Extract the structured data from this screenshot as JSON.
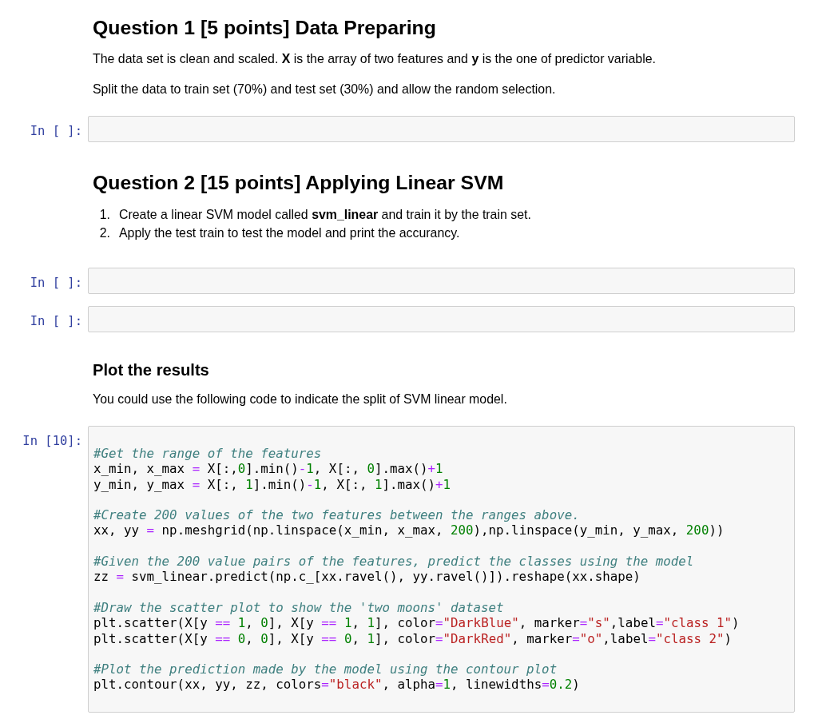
{
  "cells": [
    {
      "kind": "markdown",
      "blocks": [
        {
          "kind": "heading",
          "text": "Question 1 [5 points] Data Preparing"
        },
        {
          "kind": "paragraph",
          "text": "The data set is clean and scaled. **X** is the array of two features and **y** is the one of predictor variable."
        },
        {
          "kind": "paragraph",
          "text": "Split the data to train set (70%) and test set (30%) and allow the random selection."
        }
      ]
    },
    {
      "kind": "code",
      "prompt": "In [ ]:"
    },
    {
      "kind": "markdown",
      "blocks": [
        {
          "kind": "heading",
          "text": "Question 2 [15 points] Applying Linear SVM"
        },
        {
          "kind": "list",
          "items": [
            {
              "number": "1.",
              "text": "Create a linear SVM model called **svm_linear** and train it by the train set."
            },
            {
              "number": "2.",
              "text": "Apply the test train to test the model and print the accurancy."
            }
          ]
        }
      ]
    },
    {
      "kind": "code",
      "prompt": "In [ ]:"
    },
    {
      "kind": "code",
      "prompt": "In [ ]:"
    },
    {
      "kind": "markdown",
      "blocks": [
        {
          "kind": "subheading",
          "text": "Plot the results"
        },
        {
          "kind": "paragraph",
          "text": "You could use the following code to indicate the split of SVM linear model."
        }
      ]
    },
    {
      "kind": "code",
      "prompt": "In [10]:",
      "code": [
        [
          [
            {
              "kind": "comment",
              "text": "#Get the range of the features"
            }
          ],
          [
            {
              "kind": "plain",
              "text": "x_min, x_max "
            },
            {
              "kind": "operator",
              "text": "="
            },
            {
              "kind": "plain",
              "text": " X[:,"
            },
            {
              "kind": "number",
              "text": "0"
            },
            {
              "kind": "plain",
              "text": "].min()"
            },
            {
              "kind": "operator",
              "text": "-"
            },
            {
              "kind": "number",
              "text": "1"
            },
            {
              "kind": "plain",
              "text": ", X[:, "
            },
            {
              "kind": "number",
              "text": "0"
            },
            {
              "kind": "plain",
              "text": "].max()"
            },
            {
              "kind": "operator",
              "text": "+"
            },
            {
              "kind": "number",
              "text": "1"
            }
          ],
          [
            {
              "kind": "plain",
              "text": "y_min, y_max "
            },
            {
              "kind": "operator",
              "text": "="
            },
            {
              "kind": "plain",
              "text": " X[:, "
            },
            {
              "kind": "number",
              "text": "1"
            },
            {
              "kind": "plain",
              "text": "].min()"
            },
            {
              "kind": "operator",
              "text": "-"
            },
            {
              "kind": "number",
              "text": "1"
            },
            {
              "kind": "plain",
              "text": ", X[:, "
            },
            {
              "kind": "number",
              "text": "1"
            },
            {
              "kind": "plain",
              "text": "].max()"
            },
            {
              "kind": "operator",
              "text": "+"
            },
            {
              "kind": "number",
              "text": "1"
            }
          ]
        ],
        [
          [
            {
              "kind": "comment",
              "text": "#Create 200 values of the two features between the ranges above."
            }
          ],
          [
            {
              "kind": "plain",
              "text": "xx, yy "
            },
            {
              "kind": "operator",
              "text": "="
            },
            {
              "kind": "plain",
              "text": " np.meshgrid(np.linspace(x_min, x_max, "
            },
            {
              "kind": "number",
              "text": "200"
            },
            {
              "kind": "plain",
              "text": "),np.linspace(y_min, y_max, "
            },
            {
              "kind": "number",
              "text": "200"
            },
            {
              "kind": "plain",
              "text": "))"
            }
          ]
        ],
        [
          [
            {
              "kind": "comment",
              "text": "#Given the 200 value pairs of the features, predict the classes using the model"
            }
          ],
          [
            {
              "kind": "plain",
              "text": "zz "
            },
            {
              "kind": "operator",
              "text": "="
            },
            {
              "kind": "plain",
              "text": " svm_linear.predict(np.c_[xx.ravel(), yy.ravel()]).reshape(xx.shape)"
            }
          ]
        ],
        [
          [
            {
              "kind": "comment",
              "text": "#Draw the scatter plot to show the 'two moons' dataset"
            }
          ],
          [
            {
              "kind": "plain",
              "text": "plt.scatter(X[y "
            },
            {
              "kind": "operator",
              "text": "=="
            },
            {
              "kind": "number",
              "text": " 1"
            },
            {
              "kind": "plain",
              "text": ", "
            },
            {
              "kind": "number",
              "text": "0"
            },
            {
              "kind": "plain",
              "text": "], X[y "
            },
            {
              "kind": "operator",
              "text": "=="
            },
            {
              "kind": "number",
              "text": " 1"
            },
            {
              "kind": "plain",
              "text": ", "
            },
            {
              "kind": "number",
              "text": "1"
            },
            {
              "kind": "plain",
              "text": "], color"
            },
            {
              "kind": "operator",
              "text": "="
            },
            {
              "kind": "string",
              "text": "\"DarkBlue\""
            },
            {
              "kind": "plain",
              "text": ", marker"
            },
            {
              "kind": "operator",
              "text": "="
            },
            {
              "kind": "string",
              "text": "\"s\""
            },
            {
              "kind": "plain",
              "text": ",label"
            },
            {
              "kind": "operator",
              "text": "="
            },
            {
              "kind": "string",
              "text": "\"class 1\""
            },
            {
              "kind": "plain",
              "text": ")"
            }
          ],
          [
            {
              "kind": "plain",
              "text": "plt.scatter(X[y "
            },
            {
              "kind": "operator",
              "text": "=="
            },
            {
              "kind": "number",
              "text": " 0"
            },
            {
              "kind": "plain",
              "text": ", "
            },
            {
              "kind": "number",
              "text": "0"
            },
            {
              "kind": "plain",
              "text": "], X[y "
            },
            {
              "kind": "operator",
              "text": "=="
            },
            {
              "kind": "number",
              "text": " 0"
            },
            {
              "kind": "plain",
              "text": ", "
            },
            {
              "kind": "number",
              "text": "1"
            },
            {
              "kind": "plain",
              "text": "], color"
            },
            {
              "kind": "operator",
              "text": "="
            },
            {
              "kind": "string",
              "text": "\"DarkRed\""
            },
            {
              "kind": "plain",
              "text": ", marker"
            },
            {
              "kind": "operator",
              "text": "="
            },
            {
              "kind": "string",
              "text": "\"o\""
            },
            {
              "kind": "plain",
              "text": ",label"
            },
            {
              "kind": "operator",
              "text": "="
            },
            {
              "kind": "string",
              "text": "\"class 2\""
            },
            {
              "kind": "plain",
              "text": ")"
            }
          ]
        ],
        [
          [
            {
              "kind": "comment",
              "text": "#Plot the prediction made by the model using the contour plot"
            }
          ],
          [
            {
              "kind": "plain",
              "text": "plt.contour(xx, yy, zz, colors"
            },
            {
              "kind": "operator",
              "text": "="
            },
            {
              "kind": "string",
              "text": "\"black\""
            },
            {
              "kind": "plain",
              "text": ", alpha"
            },
            {
              "kind": "operator",
              "text": "="
            },
            {
              "kind": "number",
              "text": "1"
            },
            {
              "kind": "plain",
              "text": ", linewidths"
            },
            {
              "kind": "operator",
              "text": "="
            },
            {
              "kind": "number",
              "text": "0.2"
            },
            {
              "kind": "plain",
              "text": ")"
            }
          ]
        ]
      ]
    }
  ]
}
